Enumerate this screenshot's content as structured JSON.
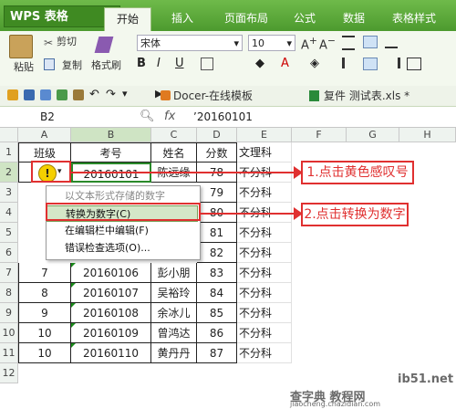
{
  "app": {
    "name": "WPS 表格"
  },
  "tabs": [
    "开始",
    "插入",
    "页面布局",
    "公式",
    "数据",
    "表格样式"
  ],
  "ribbon": {
    "cut": "剪切",
    "paste": "粘贴",
    "copy": "复制",
    "format_painter": "格式刷",
    "font_name": "宋体",
    "font_size": "10"
  },
  "doc_tabs": {
    "docer": "Docer-在线模板",
    "file": "复件 测试表.xls *"
  },
  "formula_bar": {
    "name_box": "B2",
    "fx": "fx",
    "content": "’20160101"
  },
  "grid": {
    "columns": [
      "A",
      "B",
      "C",
      "D",
      "E",
      "F",
      "G",
      "H"
    ],
    "rows": [
      "1",
      "2",
      "3",
      "4",
      "5",
      "6",
      "7",
      "8",
      "9",
      "10",
      "11",
      "12"
    ],
    "header": [
      "班级",
      "考号",
      "姓名",
      "分数",
      "文理科"
    ],
    "data": [
      [
        "",
        "20160101",
        "陈远缘",
        "78",
        "不分科"
      ],
      [
        "",
        "",
        "",
        "79",
        "不分科"
      ],
      [
        "",
        "",
        "",
        "80",
        "不分科"
      ],
      [
        "",
        "",
        "",
        "81",
        "不分科"
      ],
      [
        "",
        "",
        "",
        "82",
        "不分科"
      ],
      [
        "7",
        "20160106",
        "彭小朋",
        "83",
        "不分科"
      ],
      [
        "8",
        "20160107",
        "吴裕玲",
        "84",
        "不分科"
      ],
      [
        "9",
        "20160108",
        "余冰儿",
        "85",
        "不分科"
      ],
      [
        "10",
        "20160109",
        "曾鸿达",
        "86",
        "不分科"
      ],
      [
        "10",
        "20160110",
        "黄丹丹",
        "87",
        "不分科"
      ]
    ]
  },
  "context_menu": [
    {
      "label": "以文本形式存储的数字",
      "disabled": true
    },
    {
      "label": "转换为数字(C)",
      "highlighted": true
    },
    {
      "label": "在编辑栏中编辑(F)"
    },
    {
      "label": "错误检查选项(O)..."
    }
  ],
  "annotations": {
    "step1": "1.点击黄色感叹号",
    "step2": "2.点击转换为数字"
  },
  "watermark": {
    "line1": "ib51.net",
    "line2": "查字典 教程网",
    "line3": "jiaocheng.chazidian.com"
  },
  "colors": {
    "accent_green": "#4c9a2e",
    "annotation_red": "#e03030",
    "warning_yellow": "#f5d000"
  }
}
